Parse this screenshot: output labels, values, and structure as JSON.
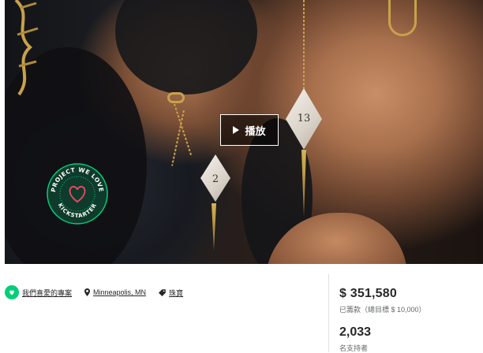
{
  "video": {
    "play_label": "播放",
    "badge": {
      "top_text": "PROJECT WE LOVE",
      "bottom_text": "KICKSTARTER"
    },
    "dice": [
      {
        "label": "2"
      },
      {
        "label": "13"
      }
    ]
  },
  "meta": {
    "project_we_love": "我們喜愛的專案",
    "location": "Minneapolis, MN",
    "category": "珠寶"
  },
  "stats": {
    "pledged_amount": "$ 351,580",
    "pledged_sub": "已籌款（總目標 $ 10,000）",
    "backers_count": "2,033",
    "backers_label": "名支持者"
  },
  "colors": {
    "brand_green": "#05ce78",
    "gold": "#c9a14a"
  }
}
